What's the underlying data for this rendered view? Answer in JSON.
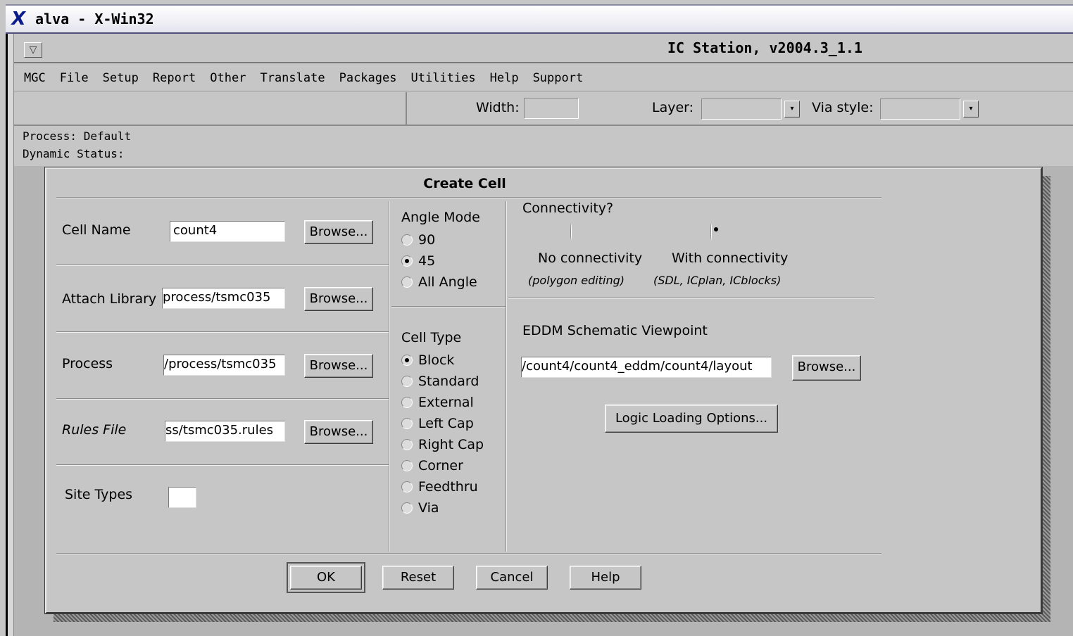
{
  "window": {
    "title": "alva - X-Win32",
    "app_title": "IC Station, v2004.3_1.1",
    "window_menu_glyph": "▽"
  },
  "menubar": [
    "MGC",
    "File",
    "Setup",
    "Report",
    "Other",
    "Translate",
    "Packages",
    "Utilities",
    "Help",
    "Support"
  ],
  "toolbar": {
    "width_label": "Width:",
    "width_value": "",
    "layer_label": "Layer:",
    "layer_value": "",
    "via_style_label": "Via style:",
    "via_style_value": "",
    "dropdown_glyph": "▾"
  },
  "status": {
    "process": "Process: Default",
    "dynamic": "Dynamic Status:"
  },
  "dialog": {
    "title": "Create Cell",
    "browse_label": "Browse...",
    "cell_name": {
      "label": "Cell Name",
      "value": "count4"
    },
    "attach_library": {
      "label": "Attach Library",
      "value": "process/tsmc035"
    },
    "process": {
      "label": "Process",
      "value": "/process/tsmc035"
    },
    "rules_file": {
      "label": "Rules File",
      "value": "ss/tsmc035.rules"
    },
    "site_types": {
      "label": "Site Types",
      "value": ""
    },
    "angle_mode": {
      "label": "Angle Mode",
      "options": [
        "90",
        "45",
        "All Angle"
      ],
      "selected": "45"
    },
    "cell_type": {
      "label": "Cell Type",
      "options": [
        "Block",
        "Standard",
        "External",
        "Left Cap",
        "Right Cap",
        "Corner",
        "Feedthru",
        "Via"
      ],
      "selected": "Block"
    },
    "connectivity": {
      "label": "Connectivity?",
      "no_label": "No connectivity",
      "no_sub": "(polygon editing)",
      "with_label": "With connectivity",
      "with_sub": "(SDL, ICplan, ICblocks)",
      "selected": "with"
    },
    "eddm": {
      "label": "EDDM Schematic Viewpoint",
      "value": "/count4/count4_eddm/count4/layout"
    },
    "logic_loading_label": "Logic Loading Options...",
    "buttons": {
      "ok": "OK",
      "reset": "Reset",
      "cancel": "Cancel",
      "help": "Help"
    }
  },
  "colors": {
    "background": "#c6c6c6",
    "field": "#ffffff",
    "logo": "#0a1a8a"
  }
}
